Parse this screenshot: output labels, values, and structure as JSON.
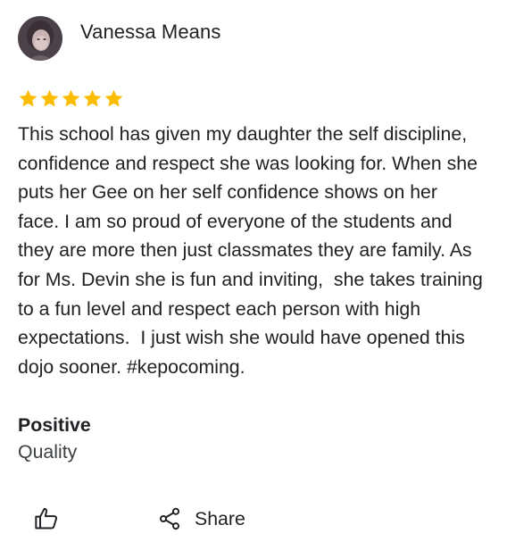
{
  "review": {
    "reviewer_name": "Vanessa Means",
    "rating": 5,
    "rating_max": 5,
    "star_color": "#fbbc04",
    "text": "This school has given my daughter the self discipline,\nconfidence and respect she was looking for. When she\nputs her Gee on her self confidence shows on her\nface. I am so proud of everyone of the students and\nthey are more then just classmates they are family. As\nfor Ms. Devin she is fun and inviting,  she takes training\nto a fun level and respect each person with high\nexpectations.  I just wish she would have opened this\ndojo sooner. #kepocoming.",
    "attribute_title": "Positive",
    "attribute_value": "Quality"
  },
  "actions": {
    "like_icon": "thumbs-up-icon",
    "share_icon": "share-icon",
    "share_label": "Share"
  }
}
